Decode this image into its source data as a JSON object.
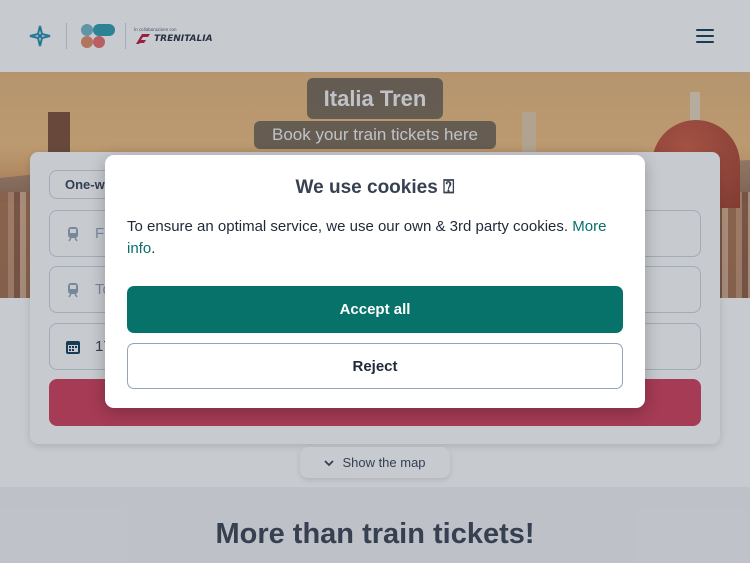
{
  "header": {
    "partner_small": "In collaborazione con",
    "partner_name": "TRENITALIA",
    "logo_icons": [
      "compass-logo-icon",
      "brand-blobs-logo-icon",
      "trenitalia-logo-icon"
    ],
    "menu_icon": "hamburger-menu-icon"
  },
  "hero": {
    "title": "Italia Tren",
    "subtitle": "Book your train tickets here"
  },
  "search": {
    "trip_type": "One-w",
    "from_placeholder": "Fr",
    "to_placeholder": "To",
    "date_value": "17",
    "icons": {
      "from": "train-icon",
      "to": "train-icon",
      "date": "calendar-icon"
    }
  },
  "map_toggle": {
    "label": "Show the map",
    "icon": "chevron-down-icon"
  },
  "lower": {
    "title": "More than train tickets!"
  },
  "cookie_modal": {
    "title": "We use cookies ⍰",
    "text": "To ensure an optimal service, we use our own & 3rd party cookies.",
    "link_text": "More info",
    "text_end": ".",
    "accept_label": "Accept all",
    "reject_label": "Reject"
  },
  "colors": {
    "accent_teal": "#06726a",
    "search_red": "#d03a56",
    "text_dark": "#374151"
  }
}
